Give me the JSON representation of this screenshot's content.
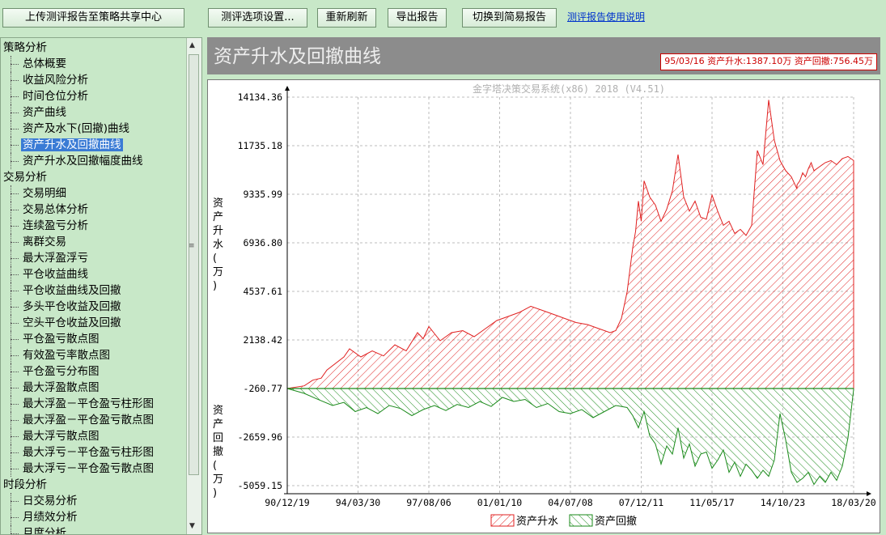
{
  "toolbar": {
    "upload_label": "上传测评报告至策略共享中心",
    "options_label": "测评选项设置...",
    "refresh_label": "重新刷新",
    "export_label": "导出报告",
    "simple_label": "切换到简易报告",
    "help_link": "测评报告使用说明"
  },
  "sidebar": {
    "groups": [
      {
        "label": "策略分析",
        "items": [
          "总体概要",
          "收益风险分析",
          "时间仓位分析",
          "资产曲线",
          "资产及水下(回撤)曲线",
          "资产升水及回撤曲线",
          "资产升水及回撤幅度曲线"
        ]
      },
      {
        "label": "交易分析",
        "items": [
          "交易明细",
          "交易总体分析",
          "连续盈亏分析",
          "离群交易",
          "最大浮盈浮亏",
          "平仓收益曲线",
          "平仓收益曲线及回撤",
          "多头平仓收益及回撤",
          "空头平仓收益及回撤",
          "平仓盈亏散点图",
          "有效盈亏率散点图",
          "平仓盈亏分布图",
          "最大浮盈散点图",
          "最大浮盈－平仓盈亏柱形图",
          "最大浮盈－平仓盈亏散点图",
          "最大浮亏散点图",
          "最大浮亏－平仓盈亏柱形图",
          "最大浮亏－平仓盈亏散点图"
        ]
      },
      {
        "label": "时段分析",
        "items": [
          "日交易分析",
          "月绩效分析",
          "月度分析"
        ]
      }
    ],
    "selected": "资产升水及回撤曲线"
  },
  "panel": {
    "title": "资产升水及回撤曲线",
    "status": "95/03/16 资产升水:1387.10万  资产回撤:756.45万"
  },
  "chart_data": {
    "type": "area",
    "watermark": "金字塔决策交易系统(x86) 2018 (V4.51)",
    "ylabel_top": "资产升水(万)",
    "ylabel_bottom": "资产回撤(万)",
    "y_ticks": [
      "14134.36",
      "11735.18",
      "9335.99",
      "6936.80",
      "4537.61",
      "2138.42",
      "-260.77",
      "-2659.96",
      "-5059.15"
    ],
    "ylim": [
      -5059.15,
      14134.36
    ],
    "x_ticks": [
      "90/12/19",
      "94/03/30",
      "97/08/06",
      "01/01/10",
      "04/07/08",
      "07/12/11",
      "11/05/17",
      "14/10/23",
      "18/03/20"
    ],
    "grid": true,
    "legend_position": "bottom",
    "series": [
      {
        "name": "资产升水",
        "color": "#e02020",
        "fill": "hatch-red",
        "x": [
          0,
          0.03,
          0.045,
          0.06,
          0.07,
          0.1,
          0.11,
          0.13,
          0.15,
          0.17,
          0.19,
          0.21,
          0.23,
          0.24,
          0.25,
          0.27,
          0.29,
          0.31,
          0.33,
          0.35,
          0.37,
          0.39,
          0.41,
          0.43,
          0.45,
          0.47,
          0.49,
          0.51,
          0.53,
          0.55,
          0.57,
          0.58,
          0.59,
          0.6,
          0.61,
          0.615,
          0.62,
          0.625,
          0.63,
          0.64,
          0.65,
          0.66,
          0.67,
          0.68,
          0.69,
          0.7,
          0.71,
          0.72,
          0.73,
          0.74,
          0.75,
          0.76,
          0.77,
          0.78,
          0.79,
          0.8,
          0.81,
          0.82,
          0.83,
          0.84,
          0.85,
          0.86,
          0.87,
          0.88,
          0.89,
          0.9,
          0.9,
          0.905,
          0.91,
          0.915,
          0.92,
          0.925,
          0.93,
          0.94,
          0.95,
          0.96,
          0.97,
          0.98,
          0.99,
          1.0,
          1.0
        ],
        "y": [
          -260,
          -130,
          150,
          250,
          650,
          1300,
          1700,
          1300,
          1600,
          1350,
          1900,
          1600,
          2500,
          2200,
          2800,
          2100,
          2500,
          2600,
          2300,
          2700,
          3100,
          3300,
          3500,
          3800,
          3600,
          3400,
          3200,
          3000,
          2900,
          2700,
          2500,
          2600,
          3200,
          4500,
          6700,
          7500,
          9000,
          8000,
          10000,
          9200,
          8800,
          8000,
          8600,
          9500,
          11300,
          9200,
          8500,
          9000,
          8200,
          8100,
          9300,
          8500,
          7800,
          8000,
          7400,
          7600,
          7300,
          7800,
          11500,
          10800,
          14000,
          12000,
          11000,
          10500,
          10200,
          9600,
          9800,
          10000,
          10400,
          10200,
          10600,
          10900,
          10500,
          10700,
          10900,
          11000,
          10800,
          11100,
          11200,
          11000,
          -260
        ]
      },
      {
        "name": "资产回撤",
        "color": "#1a8a1a",
        "fill": "hatch-green",
        "x": [
          0,
          0.03,
          0.05,
          0.08,
          0.1,
          0.12,
          0.14,
          0.16,
          0.18,
          0.2,
          0.22,
          0.24,
          0.26,
          0.28,
          0.3,
          0.32,
          0.34,
          0.36,
          0.38,
          0.4,
          0.42,
          0.44,
          0.46,
          0.48,
          0.5,
          0.52,
          0.54,
          0.56,
          0.58,
          0.6,
          0.61,
          0.62,
          0.63,
          0.64,
          0.65,
          0.66,
          0.67,
          0.68,
          0.69,
          0.7,
          0.71,
          0.72,
          0.73,
          0.74,
          0.75,
          0.76,
          0.77,
          0.78,
          0.79,
          0.8,
          0.81,
          0.82,
          0.83,
          0.84,
          0.85,
          0.86,
          0.87,
          0.88,
          0.89,
          0.9,
          0.91,
          0.92,
          0.93,
          0.94,
          0.95,
          0.96,
          0.97,
          0.98,
          0.99,
          1.0,
          1.0
        ],
        "y": [
          -260,
          -500,
          -750,
          -1100,
          -950,
          -1400,
          -1200,
          -1500,
          -1100,
          -1250,
          -1600,
          -1300,
          -1100,
          -1350,
          -1050,
          -1200,
          -900,
          -1150,
          -700,
          -900,
          -800,
          -1200,
          -1000,
          -1400,
          -1500,
          -1300,
          -1700,
          -1400,
          -1100,
          -1200,
          -1600,
          -2200,
          -1400,
          -2600,
          -3000,
          -4000,
          -3100,
          -3500,
          -2200,
          -3700,
          -3000,
          -4100,
          -3500,
          -3400,
          -4200,
          -3800,
          -3300,
          -4400,
          -3900,
          -4600,
          -4000,
          -4300,
          -4700,
          -4300,
          -4600,
          -3800,
          -1500,
          -2800,
          -4400,
          -4900,
          -4700,
          -4400,
          -5000,
          -4600,
          -4900,
          -4400,
          -4800,
          -4100,
          -2700,
          -300,
          -260
        ]
      }
    ]
  }
}
